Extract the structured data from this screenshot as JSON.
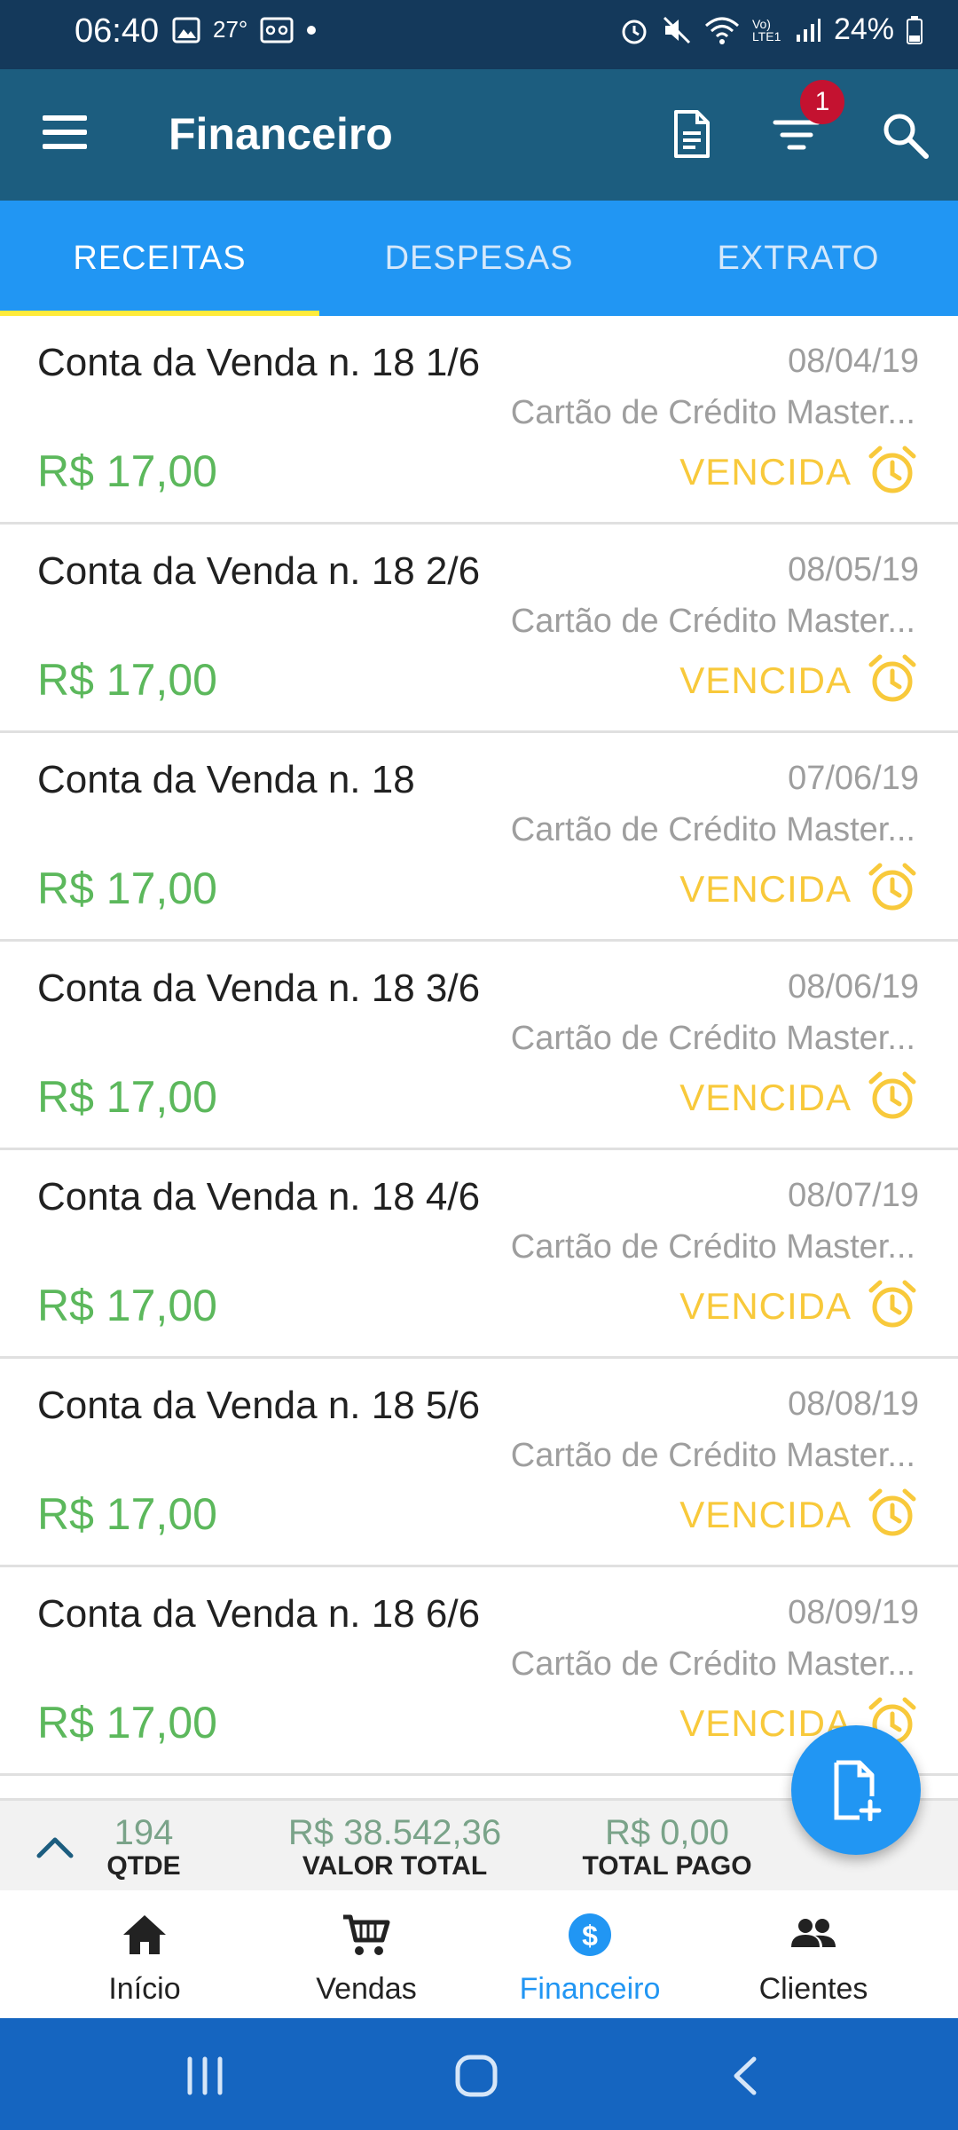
{
  "status_bar": {
    "time": "06:40",
    "temperature": "27°",
    "battery": "24%",
    "icons": [
      "photo-icon",
      "voicemail-icon",
      "dot-icon",
      "alarm-icon",
      "mute-icon",
      "wifi-icon",
      "volte-icon",
      "signal-icon",
      "battery-icon"
    ],
    "volte_label": "Vo) LTE1"
  },
  "app_bar": {
    "title": "Financeiro",
    "filter_badge": "1",
    "icons": [
      "menu-icon",
      "document-icon",
      "filter-icon",
      "search-icon"
    ]
  },
  "tabs": [
    {
      "label": "RECEITAS",
      "active": true
    },
    {
      "label": "DESPESAS",
      "active": false
    },
    {
      "label": "EXTRATO",
      "active": false
    }
  ],
  "items": [
    {
      "title": "Conta da Venda n. 18 1/6",
      "date": "08/04/19",
      "subtitle": "Cartão de Crédito Master...",
      "amount": "R$ 17,00",
      "status": "VENCIDA"
    },
    {
      "title": "Conta da Venda n. 18 2/6",
      "date": "08/05/19",
      "subtitle": "Cartão de Crédito Master...",
      "amount": "R$ 17,00",
      "status": "VENCIDA"
    },
    {
      "title": "Conta da Venda n. 18",
      "date": "07/06/19",
      "subtitle": "Cartão de Crédito Master...",
      "amount": "R$ 17,00",
      "status": "VENCIDA"
    },
    {
      "title": "Conta da Venda n. 18 3/6",
      "date": "08/06/19",
      "subtitle": "Cartão de Crédito Master...",
      "amount": "R$ 17,00",
      "status": "VENCIDA"
    },
    {
      "title": "Conta da Venda n. 18 4/6",
      "date": "08/07/19",
      "subtitle": "Cartão de Crédito Master...",
      "amount": "R$ 17,00",
      "status": "VENCIDA"
    },
    {
      "title": "Conta da Venda n. 18 5/6",
      "date": "08/08/19",
      "subtitle": "Cartão de Crédito Master...",
      "amount": "R$ 17,00",
      "status": "VENCIDA"
    },
    {
      "title": "Conta da Venda n. 18 6/6",
      "date": "08/09/19",
      "subtitle": "Cartão de Crédito Master...",
      "amount": "R$ 17,00",
      "status": "VENCIDA"
    }
  ],
  "summary": {
    "qtde_value": "194",
    "qtde_label": "QTDE",
    "total_value": "R$ 38.542,36",
    "total_label": "VALOR TOTAL",
    "paid_value": "R$ 0,00",
    "paid_label": "TOTAL PAGO"
  },
  "bottom_nav": [
    {
      "label": "Início",
      "icon": "home-icon",
      "active": false
    },
    {
      "label": "Vendas",
      "icon": "cart-icon",
      "active": false
    },
    {
      "label": "Financeiro",
      "icon": "dollar-icon",
      "active": true
    },
    {
      "label": "Clientes",
      "icon": "people-icon",
      "active": false
    }
  ],
  "colors": {
    "app_bar": "#1c5d7f",
    "tabs": "#2196f3",
    "tab_indicator": "#ffeb3b",
    "amount": "#5cb85c",
    "status": "#f8c93b",
    "badge": "#c41230",
    "system_nav": "#1565c0"
  }
}
